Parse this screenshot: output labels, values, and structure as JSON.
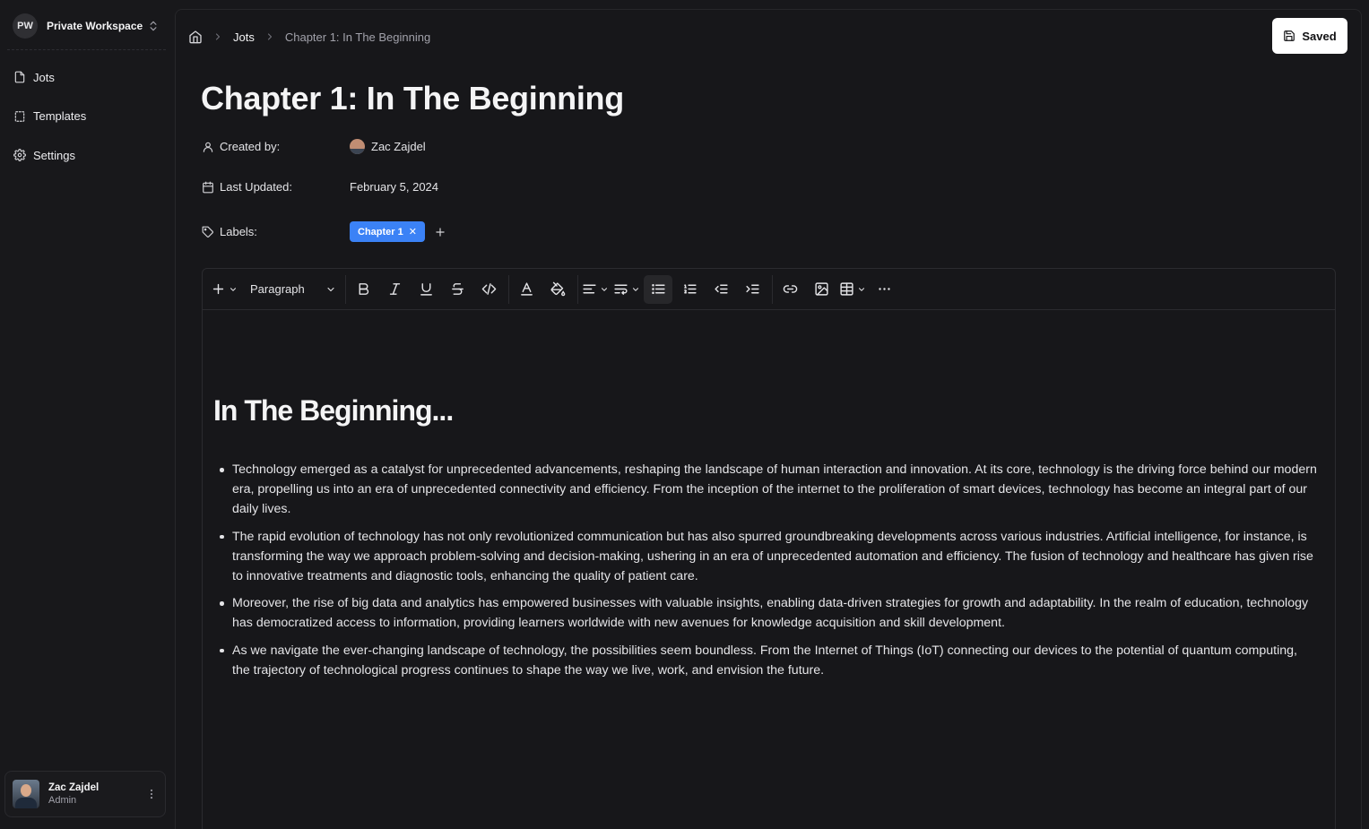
{
  "workspace": {
    "initials": "PW",
    "name": "Private Workspace"
  },
  "sidebar": {
    "items": [
      {
        "label": "Jots",
        "icon": "file-icon"
      },
      {
        "label": "Templates",
        "icon": "template-icon"
      },
      {
        "label": "Settings",
        "icon": "gear-icon"
      }
    ]
  },
  "user": {
    "name": "Zac Zajdel",
    "role": "Admin"
  },
  "breadcrumb": {
    "section": "Jots",
    "current": "Chapter 1: In The Beginning"
  },
  "save_button": {
    "label": "Saved"
  },
  "page": {
    "title": "Chapter 1: In The Beginning",
    "created_by_label": "Created by:",
    "created_by": "Zac Zajdel",
    "last_updated_label": "Last Updated:",
    "last_updated": "February 5, 2024",
    "labels_label": "Labels:",
    "labels": [
      "Chapter 1"
    ]
  },
  "toolbar": {
    "block_type": "Paragraph",
    "active": "bullet-list"
  },
  "document": {
    "heading": "In The Beginning...",
    "bullets": [
      "Technology emerged as a catalyst for unprecedented advancements, reshaping the landscape of human interaction and innovation. At its core, technology is the driving force behind our modern era, propelling us into an era of unprecedented connectivity and efficiency. From the inception of the internet to the proliferation of smart devices, technology has become an integral part of our daily lives.",
      "The rapid evolution of technology has not only revolutionized communication but has also spurred groundbreaking developments across various industries. Artificial intelligence, for instance, is transforming the way we approach problem-solving and decision-making, ushering in an era of unprecedented automation and efficiency. The fusion of technology and healthcare has given rise to innovative treatments and diagnostic tools, enhancing the quality of patient care.",
      "Moreover, the rise of big data and analytics has empowered businesses with valuable insights, enabling data-driven strategies for growth and adaptability. In the realm of education, technology has democratized access to information, providing learners worldwide with new avenues for knowledge acquisition and skill development.",
      "As we navigate the ever-changing landscape of technology, the possibilities seem boundless. From the Internet of Things (IoT) connecting our devices to the potential of quantum computing, the trajectory of technological progress continues to shape the way we live, work, and envision the future."
    ]
  },
  "colors": {
    "background": "#18181b",
    "accent": "#3b82f6",
    "text": "#e4e4e7"
  }
}
